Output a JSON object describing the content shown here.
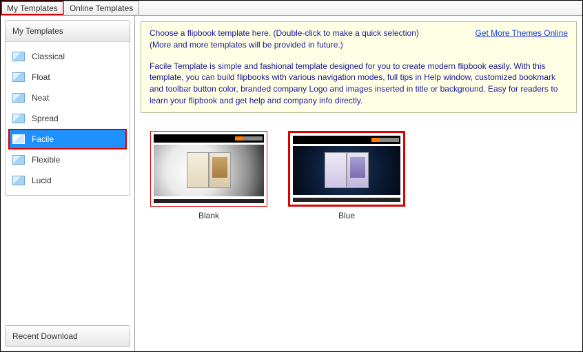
{
  "tabs": {
    "my": "My Templates",
    "online": "Online Templates"
  },
  "sidebar": {
    "header": "My Templates",
    "items": [
      {
        "label": "Classical"
      },
      {
        "label": "Float"
      },
      {
        "label": "Neat"
      },
      {
        "label": "Spread"
      },
      {
        "label": "Facile"
      },
      {
        "label": "Flexible"
      },
      {
        "label": "Lucid"
      }
    ],
    "recent": "Recent Download"
  },
  "info": {
    "line1": "Choose a flipbook template here. (Double-click to make a quick selection)",
    "line2": "(More and more templates will be provided in future.)",
    "desc": "Facile Template is simple and fashional template designed for you to create modern flipbook easily. With this template, you can build flipbooks with various navigation modes, full tips in Help window, customized bookmark and toolbar button color, branded company Logo and images inserted in title or background. Easy for readers to learn your flipbook and get help and company info directly.",
    "link": "Get More Themes Online"
  },
  "themes": [
    {
      "caption": "Blank"
    },
    {
      "caption": "Blue"
    }
  ]
}
